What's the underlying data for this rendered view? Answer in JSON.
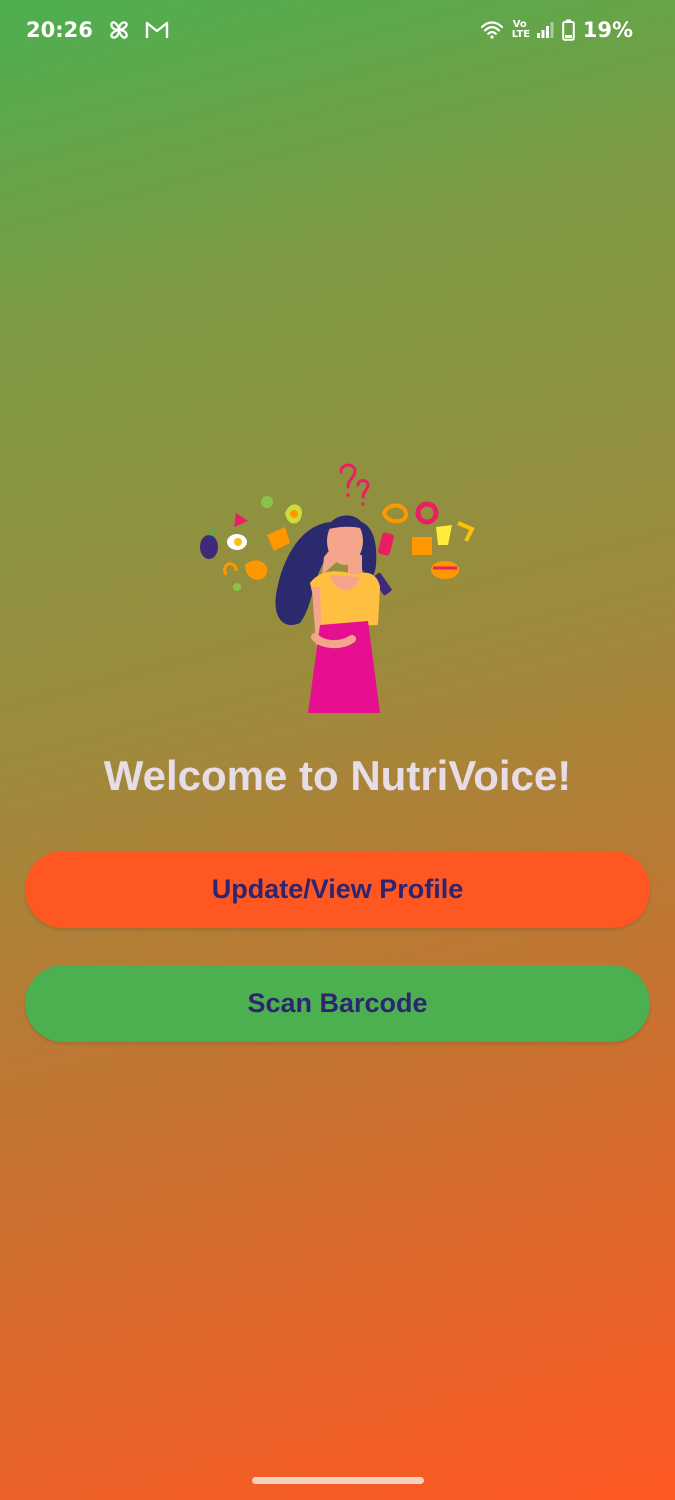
{
  "status_bar": {
    "time": "20:26",
    "volte_top": "Vo",
    "volte_bottom": "LTE",
    "battery": "19%",
    "icons": [
      "pinwheel-icon",
      "gmail-icon",
      "wifi-icon",
      "volte-icon",
      "signal-icon",
      "battery-icon"
    ]
  },
  "main": {
    "title": "Welcome to NutriVoice!",
    "illustration": "woman-thinking-about-food-illustration",
    "buttons": {
      "profile_label": "Update/View Profile",
      "scan_label": "Scan Barcode"
    }
  },
  "colors": {
    "gradient_top": "#4caf50",
    "gradient_bottom": "#ff5722",
    "profile_button": "#ff5722",
    "scan_button": "#4caf50",
    "button_text": "#2e2470",
    "title_text": "#e6dde6"
  }
}
